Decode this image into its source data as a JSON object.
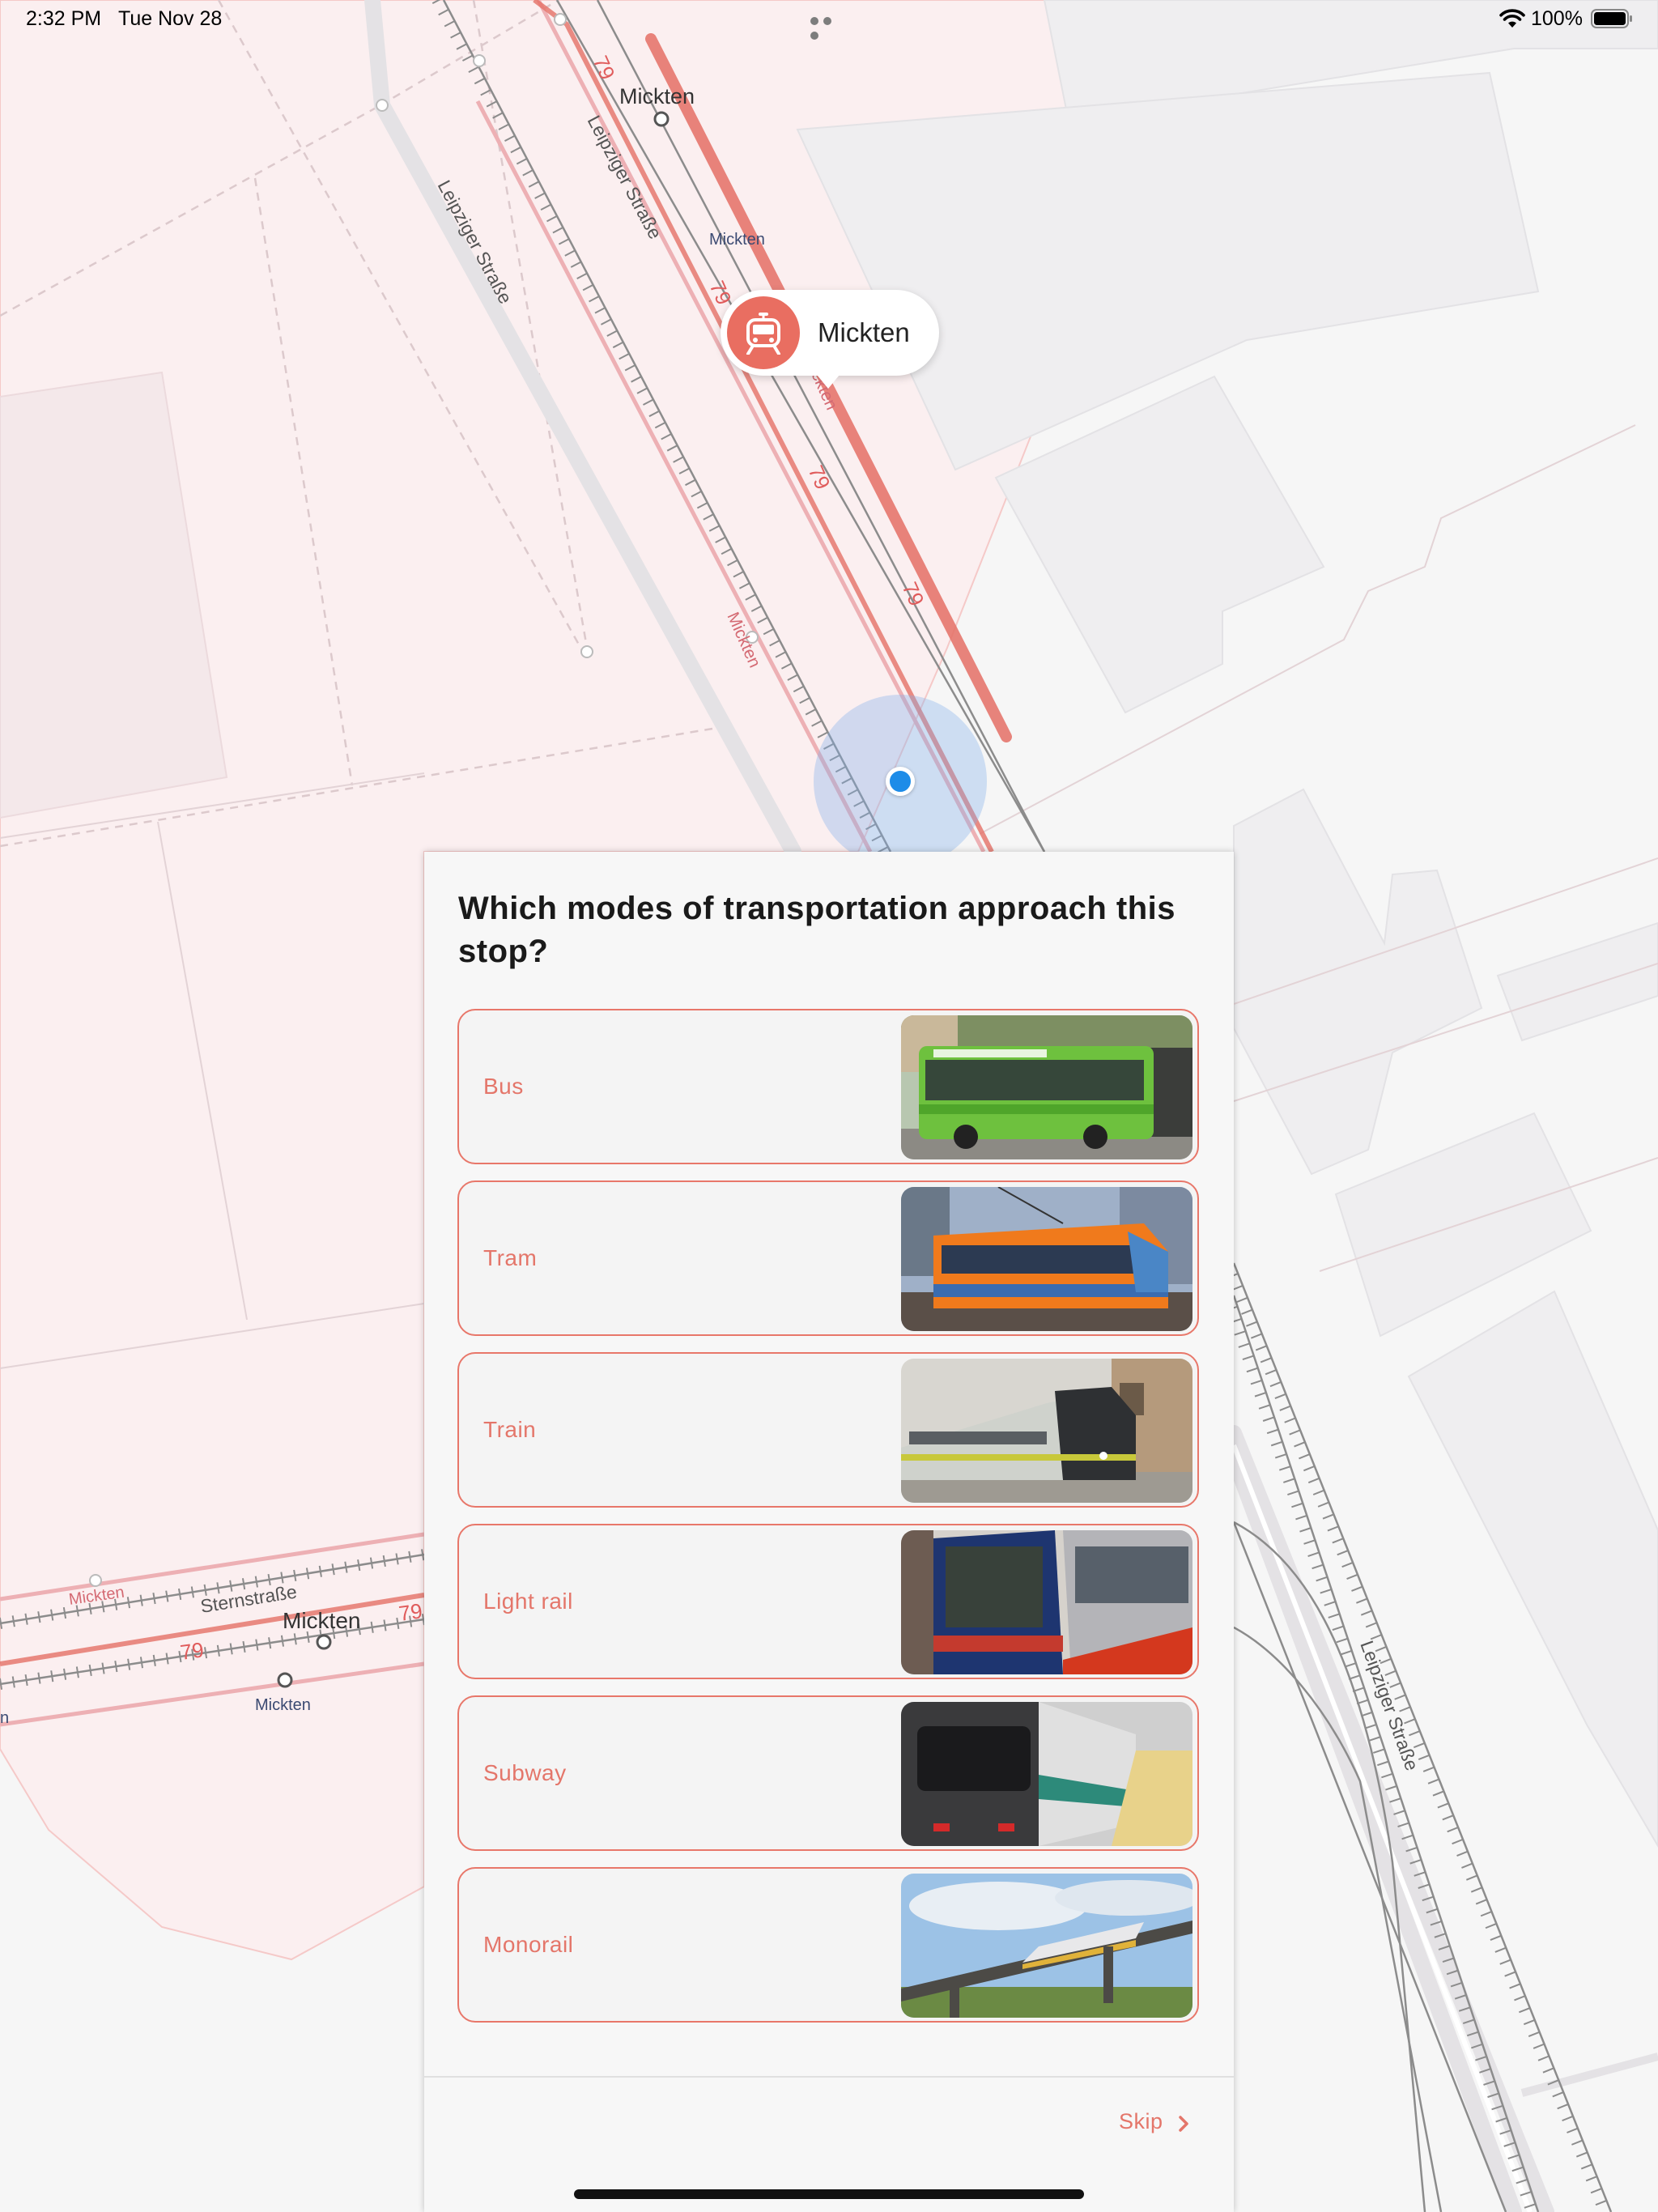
{
  "status_bar": {
    "time": "2:32 PM",
    "date": "Tue Nov 28",
    "battery": "100%"
  },
  "map": {
    "stop_callout": {
      "label": "Mickten",
      "icon": "tram-icon"
    },
    "labels": {
      "mickten_top": "Mickten",
      "mickten_small": "Mickten",
      "mickten_vertical": "Mickten",
      "mickten_callout_under": "ckten",
      "mickten_bottom": "Mickten",
      "mickten_bottom_small": "Mickten",
      "mickten_bottom_pink": "Mickten",
      "street_leipziger_1": "Leipziger Straße",
      "street_leipziger_2": "Leipziger Straße",
      "street_leipziger_3": "Leipziger Straße",
      "street_stern": "Sternstraße",
      "route_79": "79",
      "edge_n": "n"
    }
  },
  "quest": {
    "question": "Which modes of transportation approach this stop?",
    "options": [
      {
        "label": "Bus"
      },
      {
        "label": "Tram"
      },
      {
        "label": "Train"
      },
      {
        "label": "Light rail"
      },
      {
        "label": "Subway"
      },
      {
        "label": "Monorail"
      }
    ],
    "skip_label": "Skip"
  },
  "colors": {
    "accent": "#e4766a",
    "route_line": "#e57066",
    "location": "#1d8ce8"
  }
}
